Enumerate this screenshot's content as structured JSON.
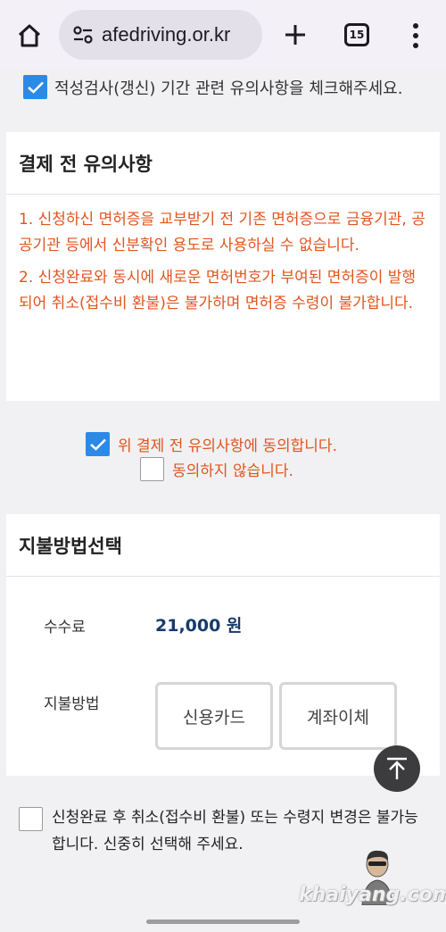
{
  "browser": {
    "url": "afedriving.or.kr",
    "tab_count": "15"
  },
  "top_check": {
    "label": "적성검사(갱신) 기간 관련 유의사항을 체크해주세요.",
    "checked": true
  },
  "notice_card": {
    "title": "결제 전 유의사항",
    "items": [
      "1. 신청하신 면허증을 교부받기 전 기존 면허증으로 금융기관, 공공기관 등에서 신분확인 용도로 사용하실 수 없습니다.",
      "2. 신청완료와 동시에 새로운 면허번호가 부여된 면허증이 발행되어 취소(접수비 환불)은 불가하며 면허증 수령이 불가합니다."
    ]
  },
  "agreement": {
    "agree_label": "위 결제 전 유의사항에 동의합니다.",
    "disagree_label": "동의하지 않습니다.",
    "selected": "agree"
  },
  "payment_card": {
    "title": "지불방법선택",
    "fee_label": "수수료",
    "fee_value": "21,000 원",
    "method_label": "지불방법",
    "methods": [
      "신용카드",
      "계좌이체"
    ]
  },
  "bottom_check": {
    "label": "신청완료 후 취소(접수비 환불) 또는 수령지 변경은 불가능합니다. 신중히 선택해 주세요.",
    "checked": false
  },
  "watermark": "khaiyang.com",
  "colors": {
    "accent_blue": "#2b8ae6",
    "notice_orange": "#e0551f",
    "fee_navy": "#163b6a"
  }
}
